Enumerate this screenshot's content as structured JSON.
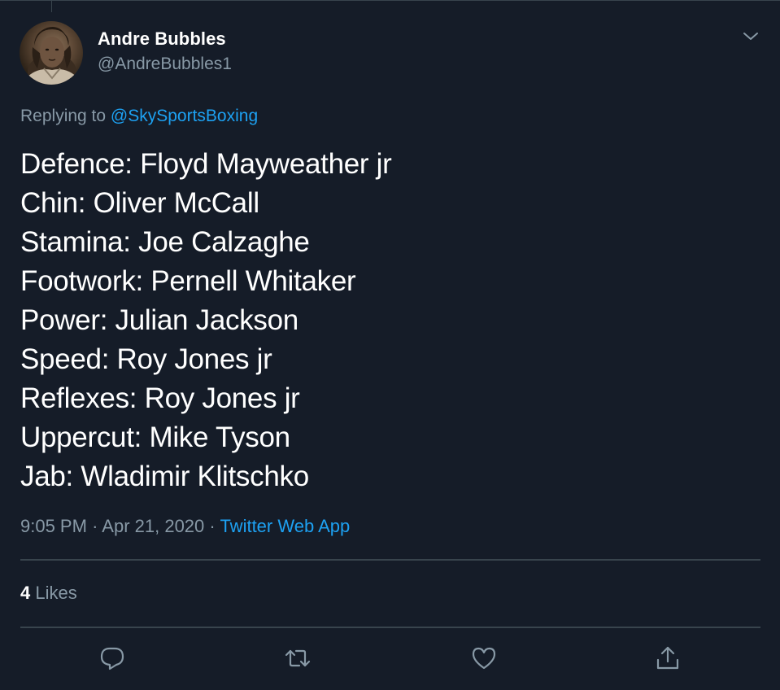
{
  "tweet": {
    "author": {
      "display_name": "Andre Bubbles",
      "handle": "@AndreBubbles1"
    },
    "reply_prefix": "Replying to",
    "reply_to": "@SkySportsBoxing",
    "lines": [
      "Defence: Floyd Mayweather jr",
      "Chin: Oliver McCall",
      "Stamina: Joe Calzaghe",
      "Footwork: Pernell Whitaker",
      "Power: Julian Jackson",
      "Speed: Roy Jones jr",
      "Reflexes: Roy Jones jr",
      "Uppercut: Mike Tyson",
      "Jab: Wladimir Klitschko"
    ],
    "time": "9:05 PM",
    "separator": "·",
    "date": "Apr 21, 2020",
    "source": "Twitter Web App",
    "likes_count": "4",
    "likes_label": "Likes"
  },
  "actions": [
    {
      "name": "reply",
      "icon": "reply-icon"
    },
    {
      "name": "retweet",
      "icon": "retweet-icon"
    },
    {
      "name": "like",
      "icon": "heart-icon"
    },
    {
      "name": "share",
      "icon": "share-icon"
    }
  ],
  "colors": {
    "background": "#151c28",
    "text": "#ffffff",
    "secondary": "#8899a6",
    "accent": "#1da1f2",
    "divider": "#38444d"
  }
}
